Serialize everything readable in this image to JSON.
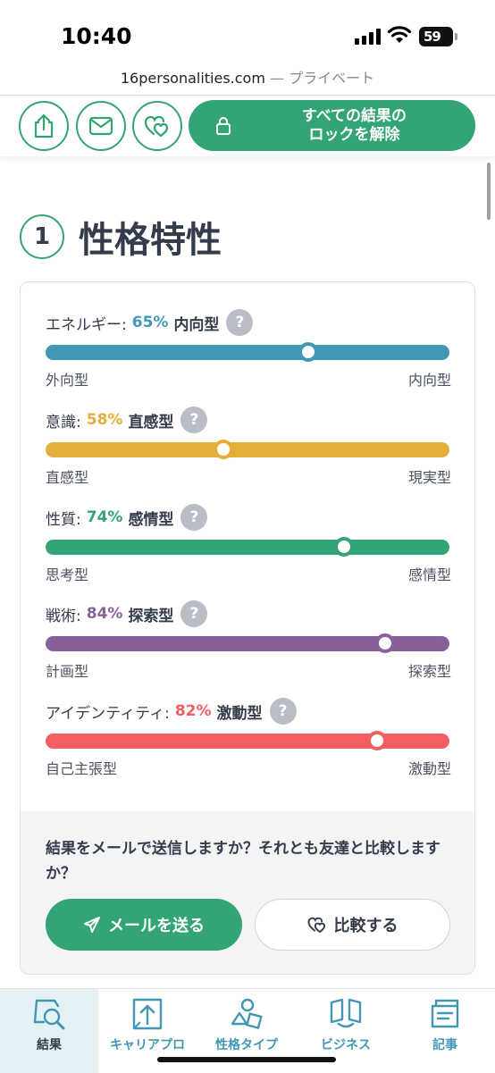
{
  "status": {
    "time": "10:40",
    "battery": "59"
  },
  "browser": {
    "domain": "16personalities.com",
    "mode": "— プライベート"
  },
  "toolbar": {
    "unlock_label_line1": "すべての結果の",
    "unlock_label_line2": "ロックを解除"
  },
  "section": {
    "number": "1",
    "title": "性格特性"
  },
  "traits": [
    {
      "label": "エネルギー:",
      "percent": "65%",
      "type": "内向型",
      "left": "外向型",
      "right": "内向型",
      "position": 0.65,
      "color": "#4298b4"
    },
    {
      "label": "意識:",
      "percent": "58%",
      "type": "直感型",
      "left": "直感型",
      "right": "現実型",
      "position": 0.44,
      "color": "#e4ae3a"
    },
    {
      "label": "性質:",
      "percent": "74%",
      "type": "感情型",
      "left": "思考型",
      "right": "感情型",
      "position": 0.74,
      "color": "#33a474"
    },
    {
      "label": "戦術:",
      "percent": "84%",
      "type": "探索型",
      "left": "計画型",
      "right": "探索型",
      "position": 0.84,
      "color": "#88619a"
    },
    {
      "label": "アイデンティティ:",
      "percent": "82%",
      "type": "激動型",
      "left": "自己主張型",
      "right": "激動型",
      "position": 0.82,
      "color": "#f25e62"
    }
  ],
  "help_symbol": "?",
  "share": {
    "question": "結果をメールで送信しますか？それとも友達と比較しますか？",
    "mail_button": "メールを送る",
    "compare_button": "比較する"
  },
  "nav": [
    {
      "label": "結果",
      "icon": "results-icon",
      "active": true
    },
    {
      "label": "キャリアプロ",
      "icon": "career-icon",
      "active": false
    },
    {
      "label": "性格タイプ",
      "icon": "personality-types-icon",
      "active": false
    },
    {
      "label": "ビジネス",
      "icon": "business-icon",
      "active": false
    },
    {
      "label": "記事",
      "icon": "articles-icon",
      "active": false
    }
  ]
}
